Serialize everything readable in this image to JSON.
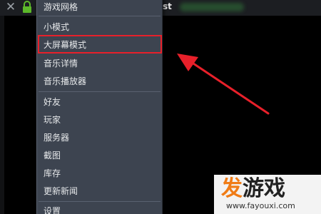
{
  "window": {
    "url_fragment": "st"
  },
  "menu": {
    "items": [
      {
        "label": "游戏网格"
      },
      {
        "label": "小模式"
      },
      {
        "label": "大屏幕模式"
      },
      {
        "label": "音乐详情"
      },
      {
        "label": "音乐播放器"
      },
      {
        "label": "好友"
      },
      {
        "label": "玩家"
      },
      {
        "label": "服务器"
      },
      {
        "label": "截图"
      },
      {
        "label": "库存"
      },
      {
        "label": "更新新闻"
      },
      {
        "label": "设置"
      }
    ]
  },
  "annotation": {
    "highlight_color": "#e8202a"
  },
  "watermark": {
    "logo_part1": "发",
    "logo_part2": "游戏",
    "url": "www.fayouxi.com"
  }
}
